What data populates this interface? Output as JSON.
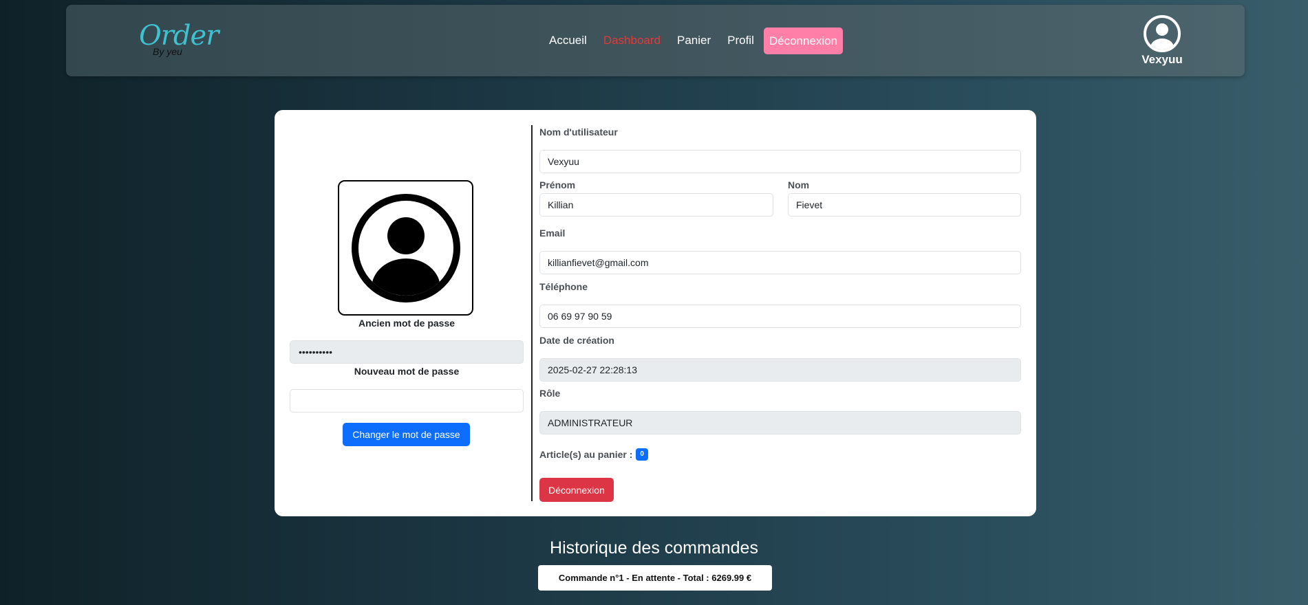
{
  "brand": {
    "logo_script": "Order",
    "logo_sub": "By yeu"
  },
  "nav": {
    "links": [
      {
        "label": "Accueil"
      },
      {
        "label": "Dashboard"
      },
      {
        "label": "Panier"
      },
      {
        "label": "Profil"
      }
    ],
    "logout_label": "Déconnexion",
    "active_color": "#e03a3a",
    "logout_color": "#ff7fa8"
  },
  "user": {
    "username": "Vexyuu",
    "icon": "user-circle-icon"
  },
  "password_panel": {
    "avatar_icon": "user-circle-icon",
    "old_label": "Ancien mot de passe",
    "old_value": "••••••••••",
    "new_label": "Nouveau mot de passe",
    "new_value": "",
    "change_button": "Changer le mot de passe"
  },
  "profile": {
    "username_label": "Nom d'utilisateur",
    "username_value": "Vexyuu",
    "firstname_label": "Prénom",
    "firstname_value": "Killian",
    "lastname_label": "Nom",
    "lastname_value": "Fievet",
    "email_label": "Email",
    "email_value": "killianfievet@gmail.com",
    "phone_label": "Téléphone",
    "phone_value": "06 69 97 90 59",
    "created_label": "Date de création",
    "created_value": "2025-02-27 22:28:13",
    "role_label": "Rôle",
    "role_value": "ADMINISTRATEUR",
    "cart_label": "Article(s) au panier :",
    "cart_count": "0",
    "logout_button": "Déconnexion"
  },
  "history": {
    "title": "Historique des commandes",
    "orders": [
      {
        "text": "Commande n°1 - En attente - Total : 6269.99 €"
      }
    ]
  },
  "colors": {
    "primary": "#0d6efd",
    "danger": "#dc3545"
  }
}
